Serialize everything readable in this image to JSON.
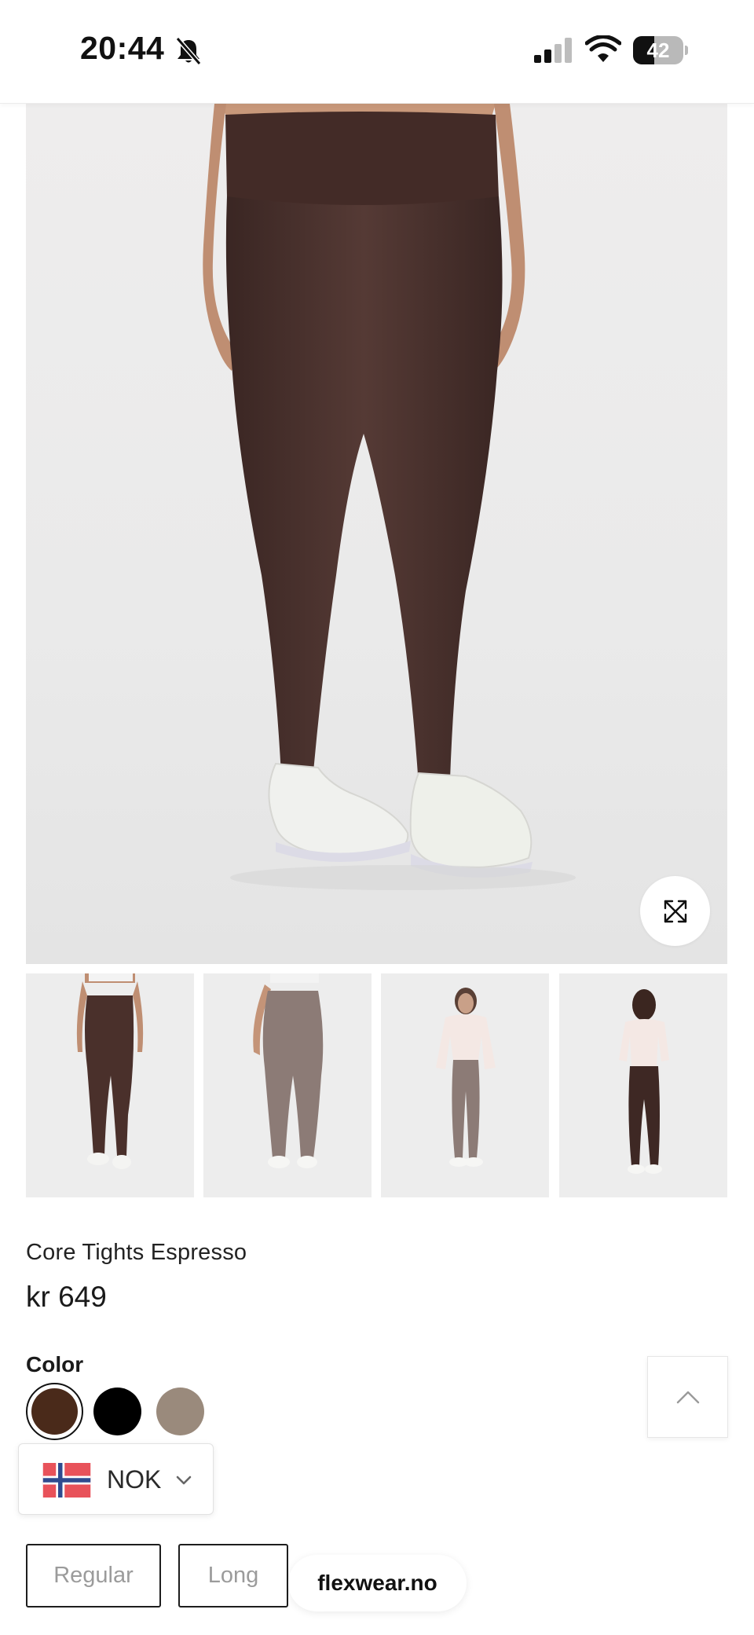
{
  "status_bar": {
    "time": "20:44",
    "battery_level": "42",
    "battery_fraction": 0.42,
    "icons": [
      "bell-off-icon",
      "cellular-signal-icon",
      "wifi-icon",
      "battery-icon"
    ]
  },
  "gallery": {
    "main_image": "product-photo-front-view",
    "expand_icon": "expand-arrows-icon",
    "thumbnails": [
      "front-view",
      "back-view",
      "styled-front-view",
      "styled-back-view"
    ]
  },
  "product": {
    "name": "Core Tights Espresso",
    "price": "kr 649"
  },
  "colors": {
    "label": "Color",
    "swatches": [
      "#4a2a1a",
      "#000000",
      "#9a8a7c"
    ],
    "selected_index": 0
  },
  "scroll_top": {
    "icon": "chevron-up-icon"
  },
  "currency": {
    "code": "NOK",
    "flag_icon": "norway-flag-icon",
    "chevron_icon": "chevron-down-icon"
  },
  "length": {
    "options": [
      "Regular",
      "Long"
    ]
  },
  "browser": {
    "domain": "flexwear.no"
  },
  "theme": {
    "legging_color": "#4a312d",
    "text_color": "#1d1d1d"
  }
}
